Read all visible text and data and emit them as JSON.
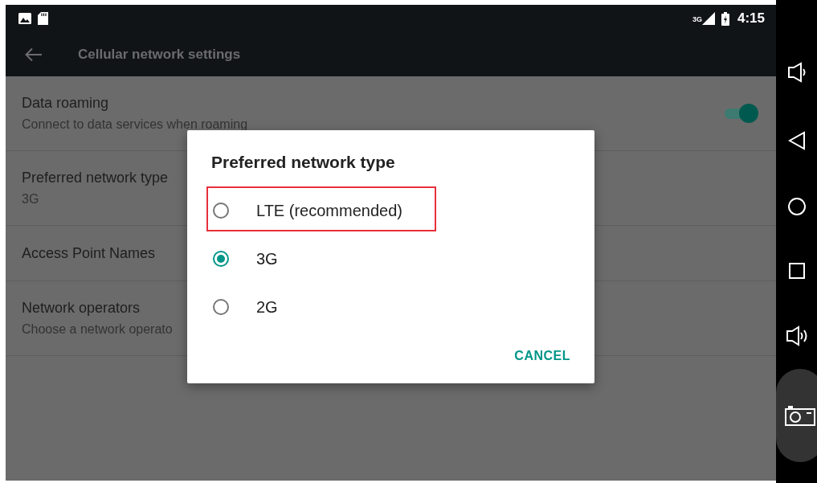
{
  "status_bar": {
    "network": "3G",
    "time": "4:15"
  },
  "toolbar": {
    "title": "Cellular network settings"
  },
  "settings": [
    {
      "title": "Data roaming",
      "summary": "Connect to data services when roaming",
      "kind": "toggle",
      "on": true
    },
    {
      "title": "Preferred network type",
      "summary": "3G",
      "kind": "text"
    },
    {
      "title": "Access Point Names",
      "kind": "text"
    },
    {
      "title": "Network operators",
      "summary": "Choose a network operato",
      "kind": "text"
    }
  ],
  "dialog": {
    "title": "Preferred network type",
    "options": [
      {
        "label": "LTE (recommended)",
        "selected": false,
        "highlighted": true
      },
      {
        "label": "3G",
        "selected": true,
        "highlighted": false
      },
      {
        "label": "2G",
        "selected": false,
        "highlighted": false
      }
    ],
    "cancel": "CANCEL"
  }
}
